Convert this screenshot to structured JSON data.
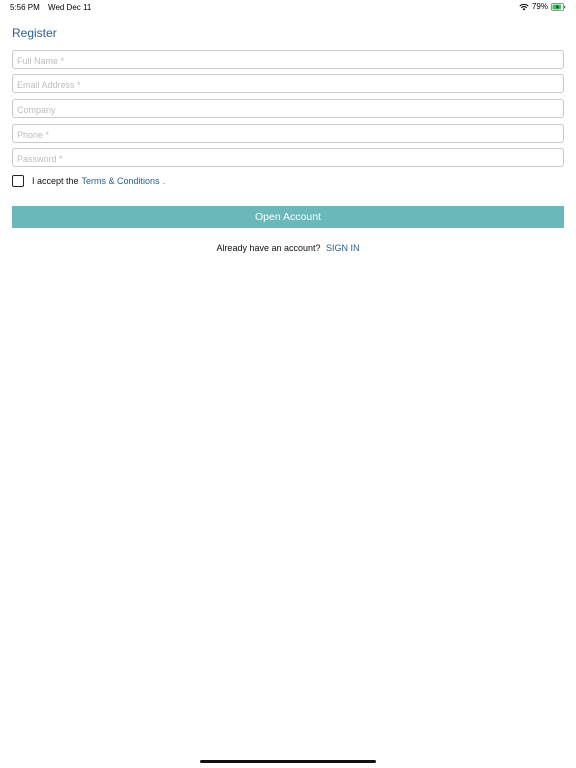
{
  "status_bar": {
    "time": "5:56 PM",
    "date": "Wed Dec 11",
    "battery_percent": "79%",
    "icons": [
      "wifi-icon",
      "battery-charging-icon"
    ]
  },
  "page": {
    "title": "Register"
  },
  "form": {
    "full_name_placeholder": "Full Name *",
    "email_placeholder": "Email Address *",
    "company_placeholder": "Company",
    "phone_placeholder": "Phone *",
    "password_placeholder": "Password *"
  },
  "terms": {
    "prefix": "I accept the",
    "link": "Terms & Conditions",
    "suffix": "."
  },
  "actions": {
    "open_account_label": "Open Account",
    "button_color": "#6bb8bb"
  },
  "signin": {
    "prompt": "Already have an account?",
    "link": "SIGN IN"
  },
  "colors": {
    "link": "#2c5d8f"
  }
}
